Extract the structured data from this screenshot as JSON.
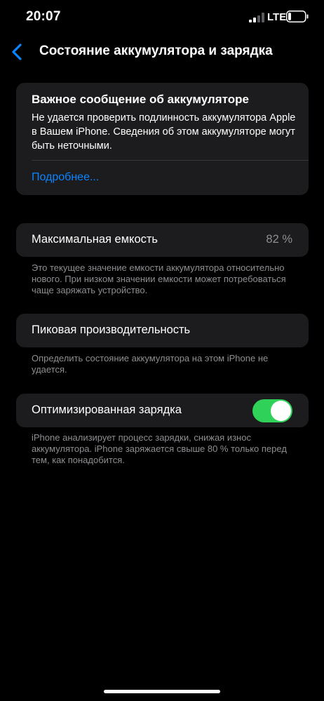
{
  "status_bar": {
    "time": "20:07",
    "network": "LTE",
    "signal_icon": "signal-bars-icon",
    "battery_icon": "battery-low-icon"
  },
  "nav": {
    "back_icon": "chevron-left-icon",
    "title": "Состояние аккумулятора и зарядка",
    "accent_color": "#0a84ff"
  },
  "alert": {
    "title": "Важное сообщение об аккумуляторе",
    "body": "Не удается проверить подлинность аккумулятора Apple в Вашем iPhone. Сведения об этом аккумуляторе могут быть неточными.",
    "link": "Подробнее..."
  },
  "capacity": {
    "label": "Максимальная емкость",
    "value": "82 %",
    "footnote": "Это текущее значение емкости аккумулятора относительно нового. При низком значении емкости может потребоваться чаще заряжать устройство."
  },
  "performance": {
    "label": "Пиковая производительность",
    "footnote": "Определить состояние аккумулятора на этом iPhone не удается."
  },
  "optimized": {
    "label": "Оптимизированная зарядка",
    "enabled": true,
    "toggle_color": "#30d158",
    "footnote": "iPhone анализирует процесс зарядки, снижая износ аккумулятора. iPhone заряжается свыше 80 % только перед тем, как понадобится."
  }
}
